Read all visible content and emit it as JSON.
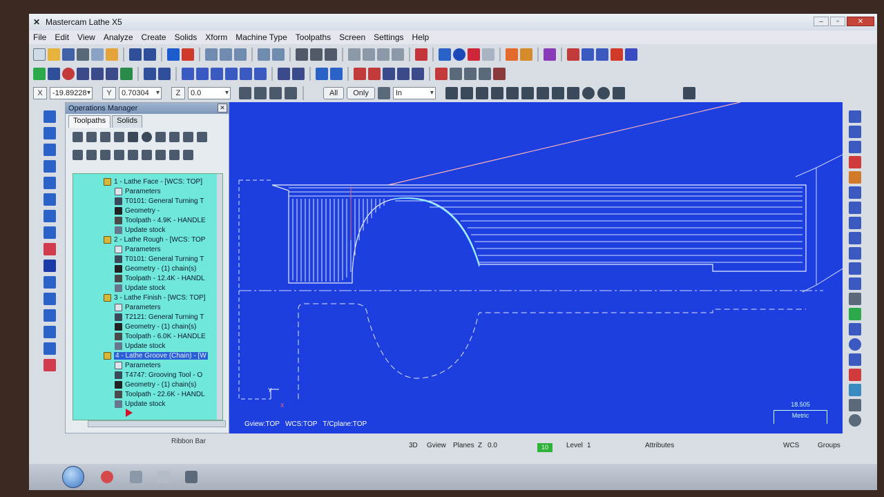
{
  "window": {
    "title": "Mastercam Lathe X5",
    "logo": "X5-logo-icon"
  },
  "menu": {
    "items": [
      "File",
      "Edit",
      "View",
      "Analyze",
      "Create",
      "Solids",
      "Xform",
      "Machine Type",
      "Toolpaths",
      "Screen",
      "Settings",
      "Help"
    ]
  },
  "coords": {
    "x_label": "X",
    "x_value": "-19.89228",
    "y_label": "Y",
    "y_value": "0.70304",
    "z_label": "Z",
    "z_value": "0.0",
    "all_label": "All",
    "only_label": "Only",
    "mode_value": "In"
  },
  "ops_manager": {
    "title": "Operations Manager",
    "tabs": [
      "Toolpaths",
      "Solids"
    ],
    "tree": [
      {
        "indent": 0,
        "icon": "folder",
        "text": "1 - Lathe Face - [WCS: TOP]"
      },
      {
        "indent": 1,
        "icon": "param",
        "text": "Parameters"
      },
      {
        "indent": 1,
        "icon": "tool",
        "text": "T0101: General Turning T"
      },
      {
        "indent": 1,
        "icon": "geom",
        "text": "Geometry -"
      },
      {
        "indent": 1,
        "icon": "path",
        "text": "Toolpath - 4.9K - HANDLE"
      },
      {
        "indent": 1,
        "icon": "stock",
        "text": "Update stock"
      },
      {
        "indent": 0,
        "icon": "folder",
        "text": "2 - Lathe Rough - [WCS: TOP"
      },
      {
        "indent": 1,
        "icon": "param",
        "text": "Parameters"
      },
      {
        "indent": 1,
        "icon": "tool",
        "text": "T0101: General Turning T"
      },
      {
        "indent": 1,
        "icon": "geom",
        "text": "Geometry - (1) chain(s)"
      },
      {
        "indent": 1,
        "icon": "path",
        "text": "Toolpath - 12.4K - HANDL"
      },
      {
        "indent": 1,
        "icon": "stock",
        "text": "Update stock"
      },
      {
        "indent": 0,
        "icon": "folder",
        "text": "3 - Lathe Finish - [WCS: TOP]"
      },
      {
        "indent": 1,
        "icon": "param",
        "text": "Parameters"
      },
      {
        "indent": 1,
        "icon": "tool",
        "text": "T2121: General Turning T"
      },
      {
        "indent": 1,
        "icon": "geom",
        "text": "Geometry - (1) chain(s)"
      },
      {
        "indent": 1,
        "icon": "path",
        "text": "Toolpath - 6.0K - HANDLE"
      },
      {
        "indent": 1,
        "icon": "stock",
        "text": "Update stock"
      },
      {
        "indent": 0,
        "icon": "folder",
        "text": "4 - Lathe Groove (Chain) - [W",
        "selected": true
      },
      {
        "indent": 1,
        "icon": "param",
        "text": "Parameters"
      },
      {
        "indent": 1,
        "icon": "tool",
        "text": "T4747: Grooving Tool - O"
      },
      {
        "indent": 1,
        "icon": "geom",
        "text": "Geometry - (1) chain(s)"
      },
      {
        "indent": 1,
        "icon": "path",
        "text": "Toolpath - 22.6K - HANDL"
      },
      {
        "indent": 1,
        "icon": "stock",
        "text": "Update stock"
      }
    ]
  },
  "graphics": {
    "gview": "Gview:TOP",
    "wcs": "WCS:TOP",
    "tcplane": "T/Cplane:TOP",
    "scale_value": "18.505",
    "scale_unit": "Metric",
    "bg_color": "#1e3fe0"
  },
  "ribbon": {
    "label": "Ribbon Bar"
  },
  "status": {
    "btn_3d": "3D",
    "btn_gview": "Gview",
    "btn_planes": "Planes",
    "z_label": "Z",
    "z_value": "0.0",
    "level_box": "10",
    "level_label": "Level",
    "level_value": "1",
    "attributes": "Attributes",
    "wcs": "WCS",
    "groups": "Groups"
  }
}
